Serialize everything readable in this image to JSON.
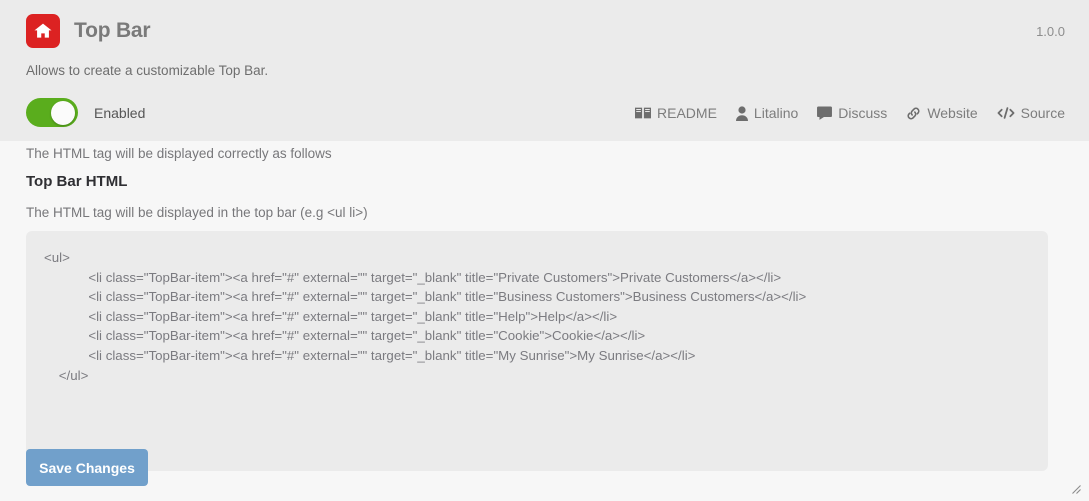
{
  "header": {
    "icon_name": "home-icon",
    "icon_color": "#dc2222",
    "title": "Top Bar",
    "version": "1.0.0",
    "description": "Allows to create a customizable Top Bar.",
    "toggle": {
      "label": "Enabled",
      "state": "on",
      "on_color": "#5aad1d"
    },
    "links": [
      {
        "label": "README",
        "icon": "book-icon"
      },
      {
        "label": "Litalino",
        "icon": "user-icon"
      },
      {
        "label": "Discuss",
        "icon": "comment-icon"
      },
      {
        "label": "Website",
        "icon": "link-icon"
      },
      {
        "label": "Source",
        "icon": "code-icon"
      }
    ]
  },
  "content": {
    "note_top": "The HTML tag will be displayed correctly as follows",
    "field_title": "Top Bar HTML",
    "field_help": "The HTML tag will be displayed in the top bar (e.g <ul li>)",
    "code_value": "<ul>\n            <li class=\"TopBar-item\"><a href=\"#\" external=\"\" target=\"_blank\" title=\"Private Customers\">Private Customers</a></li>\n            <li class=\"TopBar-item\"><a href=\"#\" external=\"\" target=\"_blank\" title=\"Business Customers\">Business Customers</a></li>\n            <li class=\"TopBar-item\"><a href=\"#\" external=\"\" target=\"_blank\" title=\"Help\">Help</a></li>\n            <li class=\"TopBar-item\"><a href=\"#\" external=\"\" target=\"_blank\" title=\"Cookie\">Cookie</a></li>\n            <li class=\"TopBar-item\"><a href=\"#\" external=\"\" target=\"_blank\" title=\"My Sunrise\">My Sunrise</a></li>\n    </ul>",
    "code_placeholder": "",
    "save_label": "Save Changes",
    "save_color": "#71a0cb"
  }
}
